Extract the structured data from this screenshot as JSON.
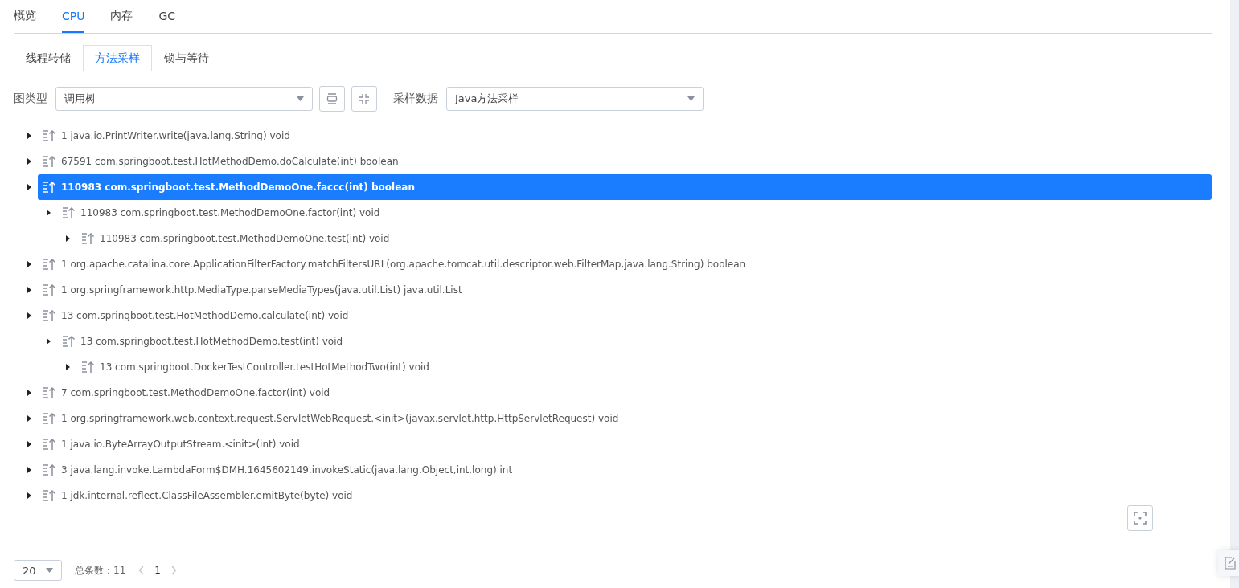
{
  "main_tabs": [
    {
      "label": "概览",
      "selected": false
    },
    {
      "label": "CPU",
      "selected": true
    },
    {
      "label": "内存",
      "selected": false
    },
    {
      "label": "GC",
      "selected": false
    }
  ],
  "sub_tabs": [
    {
      "label": "线程转储",
      "selected": false
    },
    {
      "label": "方法采样",
      "selected": true
    },
    {
      "label": "锁与等待",
      "selected": false
    }
  ],
  "toolbar": {
    "chart_type_label": "图类型",
    "chart_type_value": "调用树",
    "sample_label": "采样数据",
    "sample_value": "Java方法采样"
  },
  "tree": [
    {
      "text": "1 java.io.PrintWriter.write(java.lang.String) void",
      "selected": false
    },
    {
      "text": "67591 com.springboot.test.HotMethodDemo.doCalculate(int) boolean",
      "selected": false
    },
    {
      "text": "110983 com.springboot.test.MethodDemoOne.faccc(int) boolean",
      "selected": true,
      "children": [
        {
          "text": "110983 com.springboot.test.MethodDemoOne.factor(int) void",
          "selected": false,
          "children": [
            {
              "text": "110983 com.springboot.test.MethodDemoOne.test(int) void",
              "selected": false
            }
          ]
        }
      ]
    },
    {
      "text": "1 org.apache.catalina.core.ApplicationFilterFactory.matchFiltersURL(org.apache.tomcat.util.descriptor.web.FilterMap,java.lang.String) boolean",
      "selected": false
    },
    {
      "text": "1 org.springframework.http.MediaType.parseMediaTypes(java.util.List) java.util.List",
      "selected": false
    },
    {
      "text": "13 com.springboot.test.HotMethodDemo.calculate(int) void",
      "selected": false,
      "children": [
        {
          "text": "13 com.springboot.test.HotMethodDemo.test(int) void",
          "selected": false,
          "children": [
            {
              "text": "13 com.springboot.DockerTestController.testHotMethodTwo(int) void",
              "selected": false
            }
          ]
        }
      ]
    },
    {
      "text": "7 com.springboot.test.MethodDemoOne.factor(int) void",
      "selected": false
    },
    {
      "text": "1 org.springframework.web.context.request.ServletWebRequest.<init>(javax.servlet.http.HttpServletRequest) void",
      "selected": false
    },
    {
      "text": "1 java.io.ByteArrayOutputStream.<init>(int) void",
      "selected": false
    },
    {
      "text": "3 java.lang.invoke.LambdaForm$DMH.1645602149.invokeStatic(java.lang.Object,int,long) int",
      "selected": false
    },
    {
      "text": "1 jdk.internal.reflect.ClassFileAssembler.emitByte(byte) void",
      "selected": false
    }
  ],
  "pagination": {
    "page_size": "20",
    "total": "总条数：11",
    "page": "1"
  }
}
